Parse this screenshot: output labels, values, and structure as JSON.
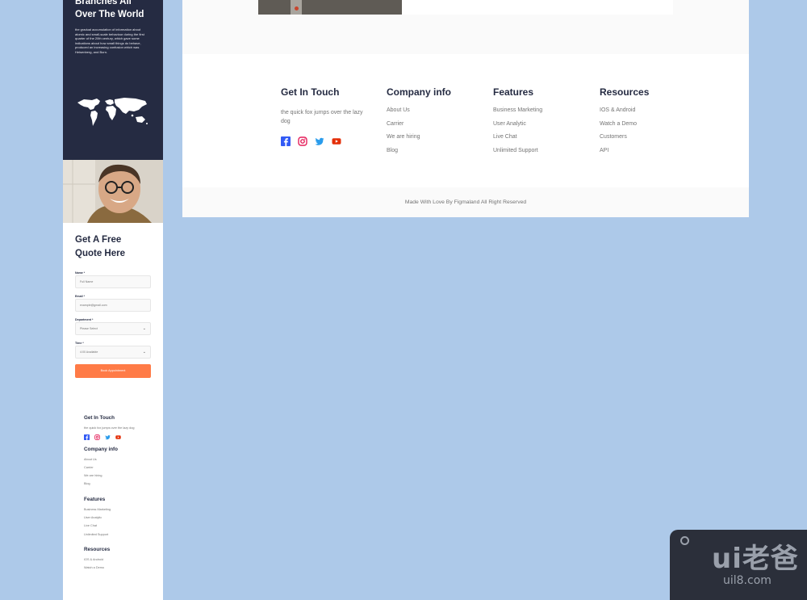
{
  "mobile": {
    "hero": {
      "title": "Branches All Over The World",
      "text": "the gradual accumulation of information about atomic and small-scale behaviour during the first quarter of the 20th century, which gave some indications about how small things do behave, produced an increasing confusion which was Heisenberg, and Born."
    },
    "quote": {
      "title": "Get A Free Quote Here",
      "fields": [
        {
          "label": "Name *",
          "value": "Full Name",
          "type": "input"
        },
        {
          "label": "Email *",
          "value": "example@gmail.com",
          "type": "input"
        },
        {
          "label": "Department *",
          "value": "Please Select",
          "type": "select"
        },
        {
          "label": "Time *",
          "value": "4:00 Available",
          "type": "select"
        }
      ],
      "button": "Book Appointment"
    },
    "footer": {
      "get_in_touch": {
        "title": "Get In Touch",
        "text": "the quick fox jumps over the lazy dog"
      },
      "company": {
        "title": "Company info",
        "links": [
          "About Us",
          "Carrier",
          "We are hiring",
          "Blog"
        ]
      },
      "features": {
        "title": "Features",
        "links": [
          "Business Marketing",
          "User Analytic",
          "Live Chat",
          "Unlimited Support"
        ]
      },
      "resources": {
        "title": "Resources",
        "links": [
          "IOS & Android",
          "Watch a Demo"
        ]
      }
    }
  },
  "desktop": {
    "get_in_touch": {
      "title": "Get In Touch",
      "text": "the quick fox jumps over the lazy dog"
    },
    "company": {
      "title": "Company info",
      "links": [
        "About Us",
        "Carrier",
        "We are hiring",
        "Blog"
      ]
    },
    "features": {
      "title": "Features",
      "links": [
        "Business Marketing",
        "User Analytic",
        "Live Chat",
        "Unlimited Support"
      ]
    },
    "resources": {
      "title": "Resources",
      "links": [
        "IOS & Android",
        "Watch a Demo",
        "Customers",
        "API"
      ]
    },
    "copyright": "Made With Love By Figmaland All Right Reserved"
  },
  "social_icons": [
    "facebook-icon",
    "instagram-icon",
    "twitter-icon",
    "youtube-icon"
  ],
  "colors": {
    "navy": "#252b42",
    "accent": "#ff7b47",
    "muted": "#737373",
    "page_bg": "#adc9e9"
  },
  "watermark": {
    "big": "ui老爸",
    "small": "uil8.com"
  }
}
